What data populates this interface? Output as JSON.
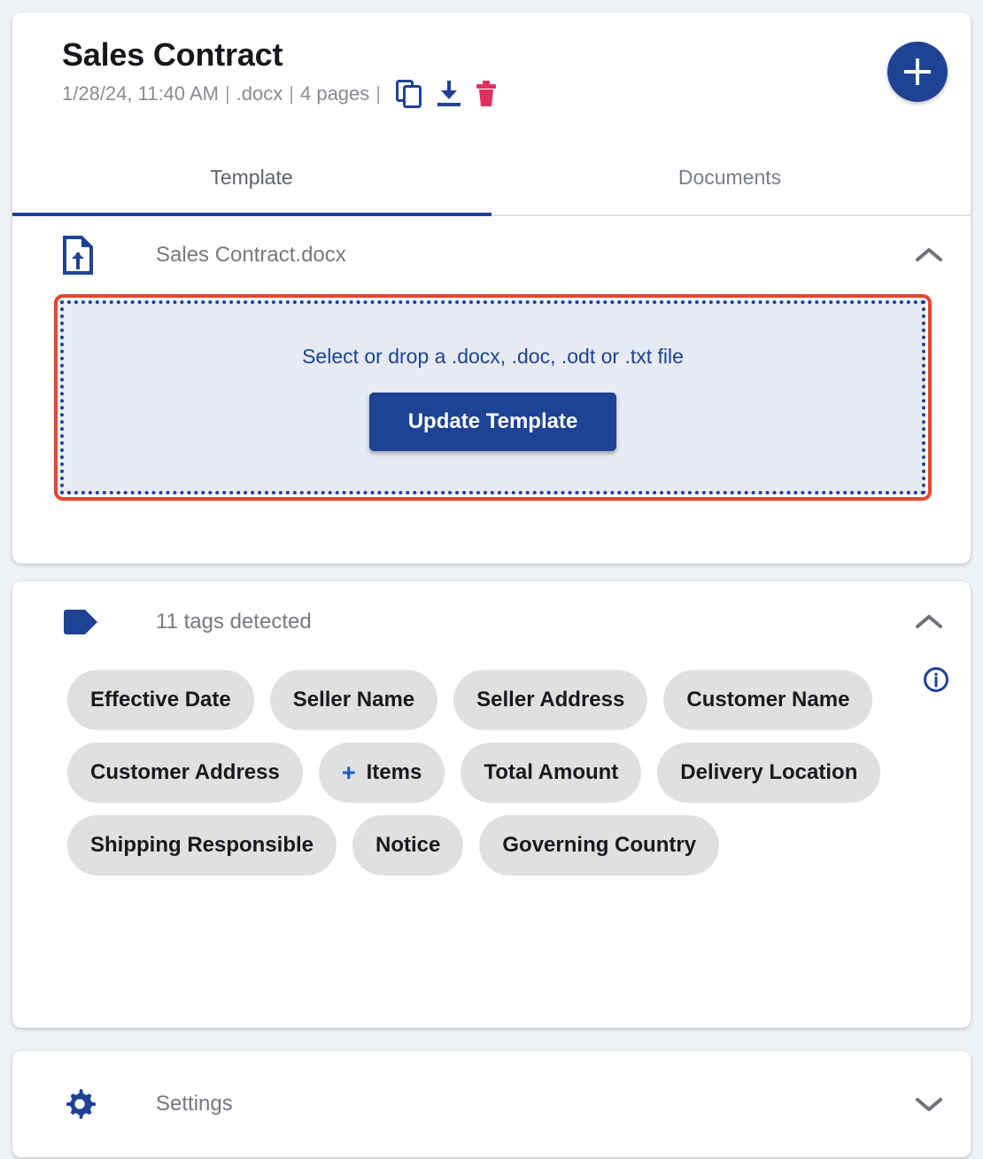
{
  "document": {
    "title": "Sales Contract",
    "date": "1/28/24, 11:40 AM",
    "filetype": ".docx",
    "pages": "4 pages",
    "separator": "|"
  },
  "header_actions": {
    "copy_icon": "copy-icon",
    "download_icon": "download-icon",
    "delete_icon": "delete-icon",
    "add_icon": "plus-icon"
  },
  "tabs": [
    {
      "label": "Template",
      "active": true
    },
    {
      "label": "Documents",
      "active": false
    }
  ],
  "template_section": {
    "icon": "file-upload-icon",
    "filename": "Sales Contract.docx",
    "chevron": "chevron-up-icon",
    "dropzone": {
      "prompt": "Select or drop a .docx, .doc, .odt or .txt file",
      "button_label": "Update Template"
    }
  },
  "tags_section": {
    "icon": "tag-icon",
    "title": "11 tags detected",
    "chevron": "chevron-up-icon",
    "info_icon": "info-circle-icon",
    "tags": [
      {
        "label": "Effective Date",
        "has_plus": false
      },
      {
        "label": "Seller Name",
        "has_plus": false
      },
      {
        "label": "Seller Address",
        "has_plus": false
      },
      {
        "label": "Customer Name",
        "has_plus": false
      },
      {
        "label": "Customer Address",
        "has_plus": false
      },
      {
        "label": "Items",
        "has_plus": true
      },
      {
        "label": "Total Amount",
        "has_plus": false
      },
      {
        "label": "Delivery Location",
        "has_plus": false
      },
      {
        "label": "Shipping Responsible",
        "has_plus": false
      },
      {
        "label": "Notice",
        "has_plus": false
      },
      {
        "label": "Governing Country",
        "has_plus": false
      }
    ],
    "plus_glyph": "+"
  },
  "settings_section": {
    "icon": "gear-icon",
    "title": "Settings",
    "chevron": "chevron-down-icon"
  },
  "colors": {
    "primary_blue": "#1e4394",
    "accent_red": "#e8452c",
    "delete_pink": "#e03060",
    "chip_gray": "#e0e0e0",
    "page_bg": "#eef1f5",
    "dropzone_bg": "#e6eaf4"
  }
}
